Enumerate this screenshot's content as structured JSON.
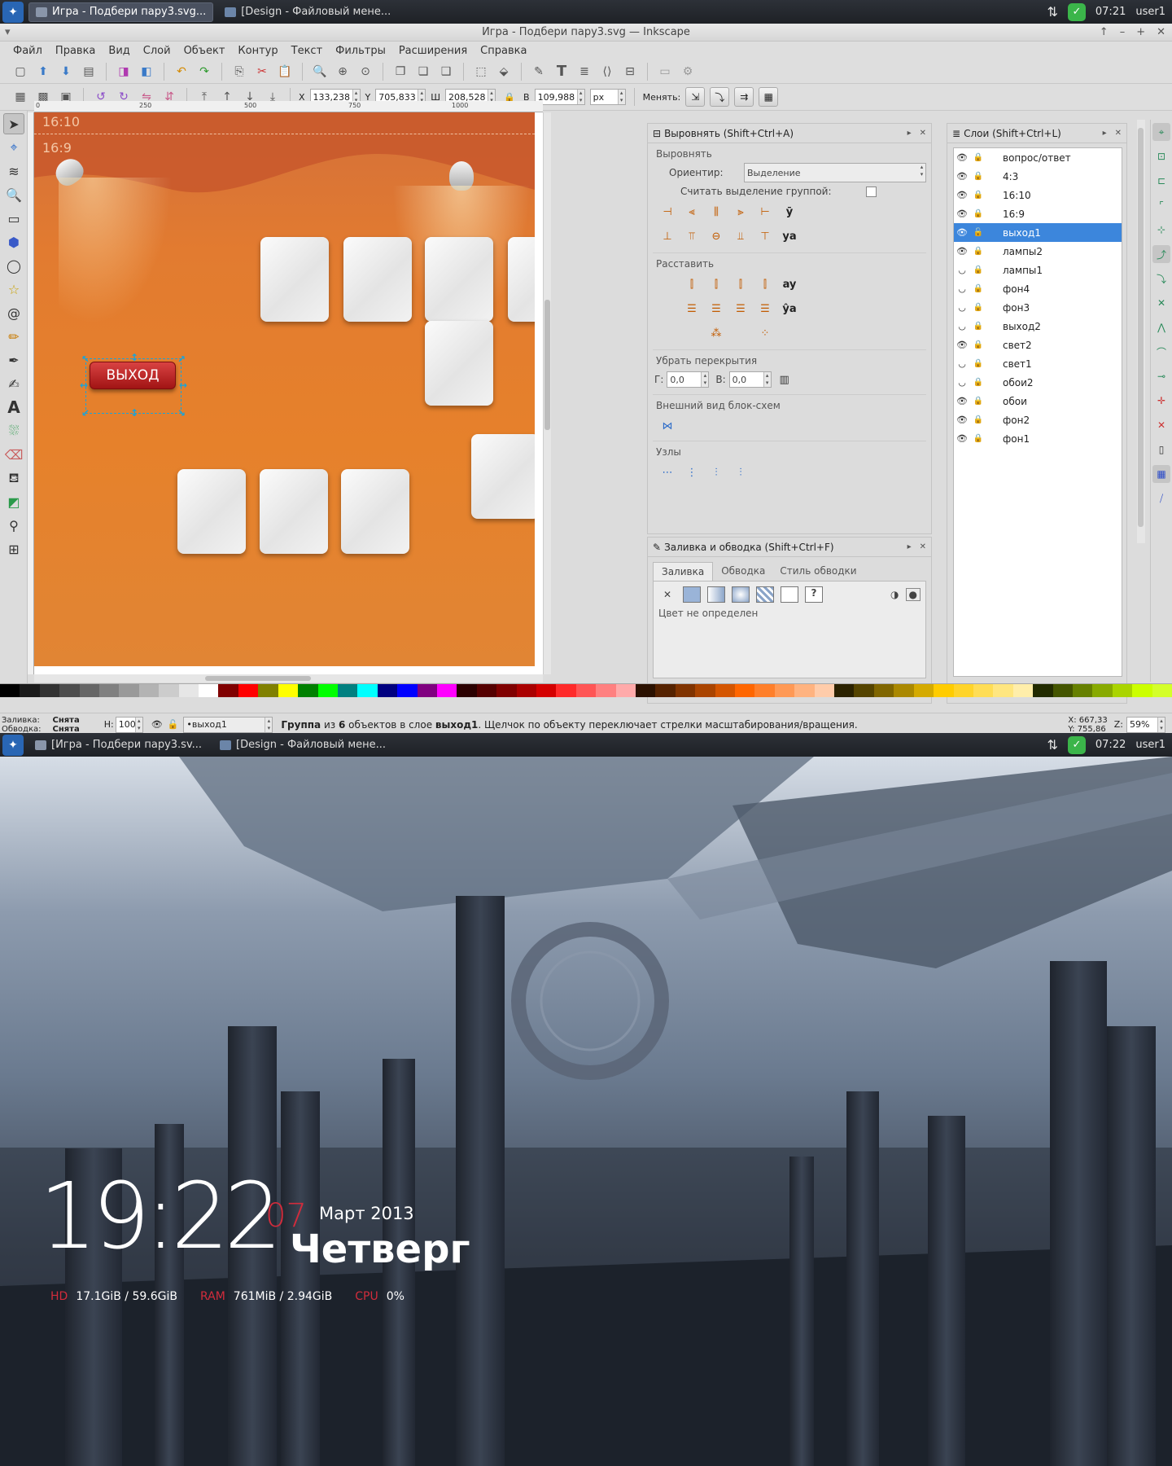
{
  "top_panel": {
    "tasks": [
      {
        "label": "Игра - Подбери пару3.svg...",
        "active": true
      },
      {
        "label": "[Design - Файловый мене...",
        "active": false
      }
    ],
    "time": "07:21",
    "user": "user1"
  },
  "window": {
    "title": "Игра - Подбери пару3.svg — Inkscape",
    "menu": [
      "Файл",
      "Правка",
      "Вид",
      "Слой",
      "Объект",
      "Контур",
      "Текст",
      "Фильтры",
      "Расширения",
      "Справка"
    ],
    "controls": {
      "x_label": "X",
      "x_value": "133,238",
      "y_label": "Y",
      "y_value": "705,833",
      "w_label": "Ш",
      "w_value": "208,528",
      "h_label": "В",
      "h_value": "109,988",
      "unit": "px",
      "change_label": "Менять:"
    },
    "rulers": {
      "h_ticks": [
        "0",
        "250",
        "500",
        "750",
        "1000"
      ]
    },
    "canvas": {
      "text_1610": "16:10",
      "text_169": "16:9",
      "exit_label": "ВЫХОД"
    },
    "align_panel": {
      "title": "Выровнять (Shift+Ctrl+A)",
      "align_section": "Выровнять",
      "orient_label": "Ориентир:",
      "orient_value": "Выделение",
      "group_label": "Считать выделение группой:",
      "distribute_section": "Расставить",
      "overlap_section": "Убрать перекрытия",
      "g_label": "Г:",
      "g_value": "0,0",
      "v_label": "В:",
      "v_value": "0,0",
      "graph_section": "Внешний вид блок-схем",
      "nodes_section": "Узлы"
    },
    "fill_panel": {
      "title": "Заливка и обводка (Shift+Ctrl+F)",
      "tabs": [
        "Заливка",
        "Обводка",
        "Стиль обводки"
      ],
      "status": "Цвет не определен"
    },
    "layers_panel": {
      "title": "Слои (Shift+Ctrl+L)",
      "layers": [
        "вопрос/ответ",
        "4:3",
        "16:10",
        "16:9",
        "выход1",
        "лампы2",
        "лампы1",
        "фон4",
        "фон3",
        "выход2",
        "свет2",
        "свет1",
        "обои2",
        "обои",
        "фон2",
        "фон1"
      ],
      "selected": "выход1"
    },
    "statusbar": {
      "fill_label": "Заливка:",
      "fill_value": "Снята",
      "stroke_label": "Обводка:",
      "stroke_value": "Снята",
      "h_label": "Н:",
      "h_value": "100",
      "layer_value": "•выход1",
      "msg_group": "Группа",
      "msg_of": " из ",
      "msg_count": "6",
      "msg_objects": " объектов в слое ",
      "msg_layer": "выход1",
      "msg_rest": ". Щелчок по объекту переключает стрелки масштабирования/вращения.",
      "x_coord": "X: 667,33",
      "y_coord": "Y: 755,86",
      "z_label": "Z:",
      "zoom": "59%"
    }
  },
  "bottom_panel": {
    "tasks": [
      {
        "label": "[Игра - Подбери пару3.sv...",
        "active": false
      },
      {
        "label": "[Design - Файловый мене...",
        "active": false
      }
    ],
    "time": "07:22",
    "user": "user1"
  },
  "desktop": {
    "clock_time": "19:22",
    "day_number": "07",
    "month_year": "Март 2013",
    "weekday": "Четверг",
    "hd_label": "HD",
    "hd_value": "17.1GiB / 59.6GiB",
    "ram_label": "RAM",
    "ram_value": "761MiB / 2.94GiB",
    "cpu_label": "CPU",
    "cpu_value": "0%"
  },
  "colors": {
    "accent": "#3c86dc",
    "exit_red": "#c22020",
    "desk_red": "#d22c3c",
    "check_green": "#3bb54a"
  }
}
